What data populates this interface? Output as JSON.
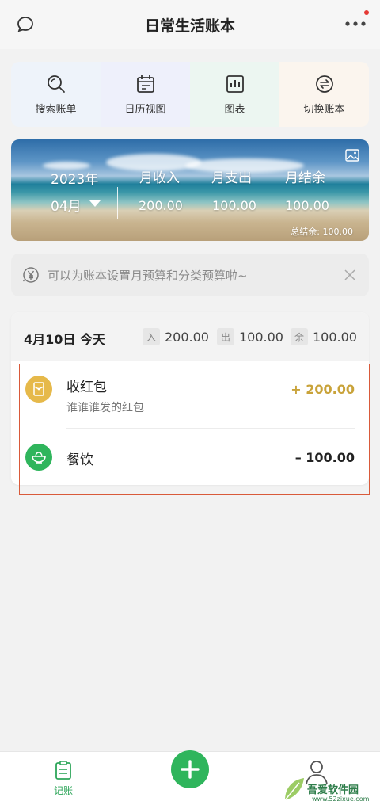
{
  "header": {
    "title": "日常生活账本"
  },
  "quick_actions": [
    {
      "label": "搜索账单",
      "icon": "search-icon",
      "bg": "#eef3fa"
    },
    {
      "label": "日历视图",
      "icon": "calendar-icon",
      "bg": "#eef0fb"
    },
    {
      "label": "图表",
      "icon": "chart-icon",
      "bg": "#ecf6f1"
    },
    {
      "label": "切换账本",
      "icon": "switch-icon",
      "bg": "#fbf5ee"
    }
  ],
  "summary": {
    "year": "2023年",
    "month": "04月",
    "income_label": "月收入",
    "expense_label": "月支出",
    "balance_label": "月结余",
    "income": "200.00",
    "expense": "100.00",
    "balance": "100.00",
    "total_balance": "总结余: 100.00"
  },
  "tip": {
    "text": "可以为账本设置月预算和分类预算啦~"
  },
  "day": {
    "date": "4月10日 今天",
    "in_tag": "入",
    "in_amount": "200.00",
    "out_tag": "出",
    "out_amount": "100.00",
    "rest_tag": "余",
    "rest_amount": "100.00"
  },
  "entries": [
    {
      "category": "收红包",
      "note": "谁谁谁发的红包",
      "amount": "+ 200.00",
      "color": "#c9a33a",
      "icon": "red-envelope-icon",
      "icon_bg": "#e6b94a"
    },
    {
      "category": "餐饮",
      "note": "",
      "amount": "– 100.00",
      "color": "#222222",
      "icon": "food-bowl-icon",
      "icon_bg": "#2fb55c"
    }
  ],
  "tabbar": {
    "record_label": "记账"
  },
  "watermark": {
    "text": "吾爱软件园",
    "url": "www.52zixue.com"
  },
  "colors": {
    "accent": "#2fb55c",
    "income": "#c9a33a"
  }
}
